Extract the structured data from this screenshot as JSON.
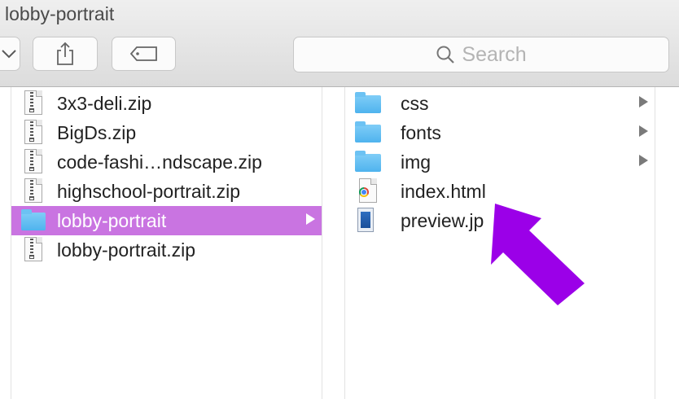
{
  "window": {
    "title": "lobby-portrait"
  },
  "toolbar": {
    "search_placeholder": "Search"
  },
  "column_left": {
    "items": [
      {
        "label": "3x3-deli.zip",
        "type": "zip"
      },
      {
        "label": "BigDs.zip",
        "type": "zip"
      },
      {
        "label": "code-fashi…ndscape.zip",
        "type": "zip"
      },
      {
        "label": "highschool-portrait.zip",
        "type": "zip"
      },
      {
        "label": "lobby-portrait",
        "type": "folder",
        "selected": true
      },
      {
        "label": "lobby-portrait.zip",
        "type": "zip"
      }
    ]
  },
  "column_right": {
    "items": [
      {
        "label": "css",
        "type": "folder"
      },
      {
        "label": "fonts",
        "type": "folder"
      },
      {
        "label": "img",
        "type": "folder"
      },
      {
        "label": "index.html",
        "type": "html"
      },
      {
        "label": "preview.jp",
        "type": "image"
      }
    ]
  },
  "colors": {
    "selection": "#c974e1",
    "annotation_arrow": "#9b00e8",
    "folder": "#5ab9f0"
  }
}
